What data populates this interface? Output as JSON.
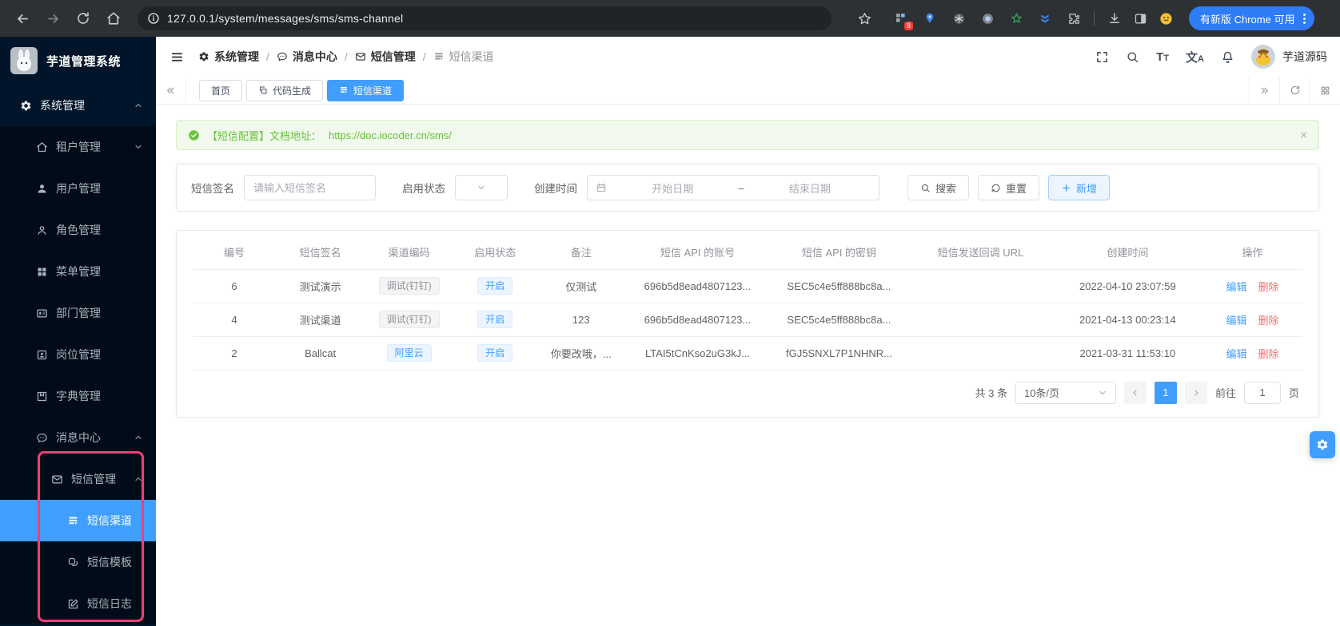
{
  "browser": {
    "url": "127.0.0.1/system/messages/sms/sms-channel",
    "extension_badge": "8",
    "update_label": "有新版 Chrome 可用"
  },
  "sidebar": {
    "logo_title": "芋道管理系统",
    "system": "系统管理",
    "tenant": "租户管理",
    "user": "用户管理",
    "role": "角色管理",
    "menu": "菜单管理",
    "dept": "部门管理",
    "post": "岗位管理",
    "dict": "字典管理",
    "message_center": "消息中心",
    "sms": "短信管理",
    "sms_channel": "短信渠道",
    "sms_template": "短信模板",
    "sms_log": "短信日志"
  },
  "header": {
    "breadcrumb": [
      "系统管理",
      "消息中心",
      "短信管理",
      "短信渠道"
    ],
    "separator": "/",
    "font_icon_big": "T",
    "font_icon_small": "T",
    "locale_icon_text": "文",
    "locale_icon_sub": "A",
    "username": "芋道源码"
  },
  "tabs": {
    "home": "首页",
    "codegen": "代码生成",
    "sms_channel": "短信渠道"
  },
  "alert": {
    "text": "【短信配置】文档地址：",
    "link": "https://doc.iocoder.cn/sms/"
  },
  "filters": {
    "sign_label": "短信签名",
    "sign_placeholder": "请输入短信签名",
    "status_label": "启用状态",
    "time_label": "创建时间",
    "start_placeholder": "开始日期",
    "range_separator": "–",
    "end_placeholder": "结束日期",
    "search_label": "搜索",
    "reset_label": "重置",
    "add_label": "新增"
  },
  "table": {
    "headers": [
      "编号",
      "短信签名",
      "渠道编码",
      "启用状态",
      "备注",
      "短信 API 的账号",
      "短信 API 的密钥",
      "短信发送回调 URL",
      "创建时间",
      "操作"
    ],
    "rows": [
      {
        "id": "6",
        "sign": "测试演示",
        "channel": "调试(钉钉)",
        "channel_type": "info",
        "status": "开启",
        "remark": "仅测试",
        "account": "696b5d8ead4807123...",
        "secret": "SEC5c4e5ff888bc8a...",
        "callback": "",
        "time": "2022-04-10 23:07:59"
      },
      {
        "id": "4",
        "sign": "测试渠道",
        "channel": "调试(钉钉)",
        "channel_type": "info",
        "status": "开启",
        "remark": "123",
        "account": "696b5d8ead4807123...",
        "secret": "SEC5c4e5ff888bc8a...",
        "callback": "",
        "time": "2021-04-13 00:23:14"
      },
      {
        "id": "2",
        "sign": "Ballcat",
        "channel": "阿里云",
        "channel_type": "primary",
        "status": "开启",
        "remark": "你要改哦，...",
        "account": "LTAI5tCnKso2uG3kJ...",
        "secret": "fGJ5SNXL7P1NHNR...",
        "callback": "",
        "time": "2021-03-31 11:53:10"
      }
    ],
    "actions": {
      "edit": "编辑",
      "delete": "删除"
    }
  },
  "pagination": {
    "total": "共 3 条",
    "page_size": "10条/页",
    "page": "1",
    "goto_label": "前往",
    "goto_value": "1",
    "page_unit": "页"
  },
  "colors": {
    "primary": "#409eff",
    "danger": "#f56c6c",
    "success": "#67c23a",
    "sidebar_bg": "#001529",
    "sidebar_submenu_bg": "#000c17",
    "annotation": "#f23d7c"
  }
}
